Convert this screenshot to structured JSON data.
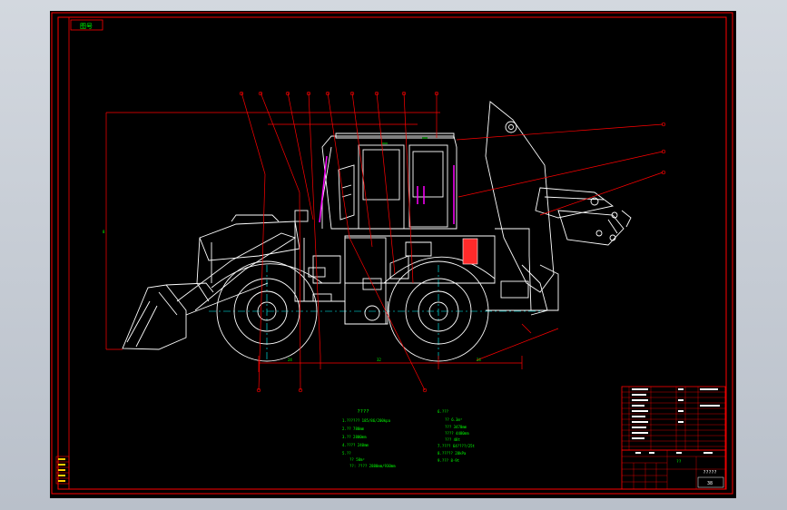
{
  "drawing": {
    "title_tag": "图号",
    "notes_title": "????",
    "colors": {
      "background": "#000000",
      "border": "#ff0000",
      "outline": "#ffffff",
      "leader": "#ff0000",
      "center_line": "#00ffff",
      "note_text": "#00ff00",
      "cylinder": "#ff00ff",
      "block": "#ff2a2a",
      "glass": "#ffffff"
    }
  },
  "specs_left": [
    "1.?????? 185/86/200kpa",
    "2.?? 780mm",
    "3.?? 2800mm",
    "4.???? 240mm",
    "5.??",
    "?? 50m²",
    "??: ???? 2880mm/930mm"
  ],
  "specs_right": [
    "6.???",
    "?? 6.3m³",
    "??? 3470mm",
    "???? 4480mm",
    "??? 48t",
    "7.???? 64????/25t",
    "8.????? 28kPa",
    "9.??? 8-9t"
  ],
  "title_block": {
    "mid_label": "??",
    "name_label": "?????",
    "code_label": "38"
  },
  "left_legend_marks": [
    "1",
    "2",
    "3",
    "4",
    "5",
    "6",
    "7",
    "8"
  ]
}
